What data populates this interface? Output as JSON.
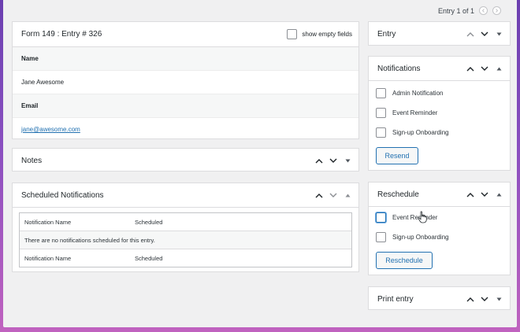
{
  "entry_nav": {
    "label": "Entry 1 of 1"
  },
  "entry_box": {
    "title": "Form 149 : Entry # 326",
    "show_empty_label": "show empty fields",
    "fields": [
      {
        "label": "Name",
        "value": "Jane Awesome"
      },
      {
        "label": "Email",
        "value": "jane@awesome.com"
      }
    ]
  },
  "notes": {
    "title": "Notes"
  },
  "scheduled": {
    "title": "Scheduled Notifications",
    "col_name": "Notification Name",
    "col_scheduled": "Scheduled",
    "empty_message": "There are no notifications scheduled for this entry."
  },
  "sidebar": {
    "entry_title": "Entry",
    "notifications": {
      "title": "Notifications",
      "items": [
        "Admin Notification",
        "Event Reminder",
        "Sign-up Onboarding"
      ],
      "button": "Resend"
    },
    "reschedule": {
      "title": "Reschedule",
      "items": [
        "Event Reminder",
        "Sign-up Onboarding"
      ],
      "button": "Reschedule"
    },
    "print_title": "Print entry"
  },
  "colors": {
    "accent": "#2271b1",
    "border": "#dcdcde",
    "canvas": "#f0f0f1"
  }
}
